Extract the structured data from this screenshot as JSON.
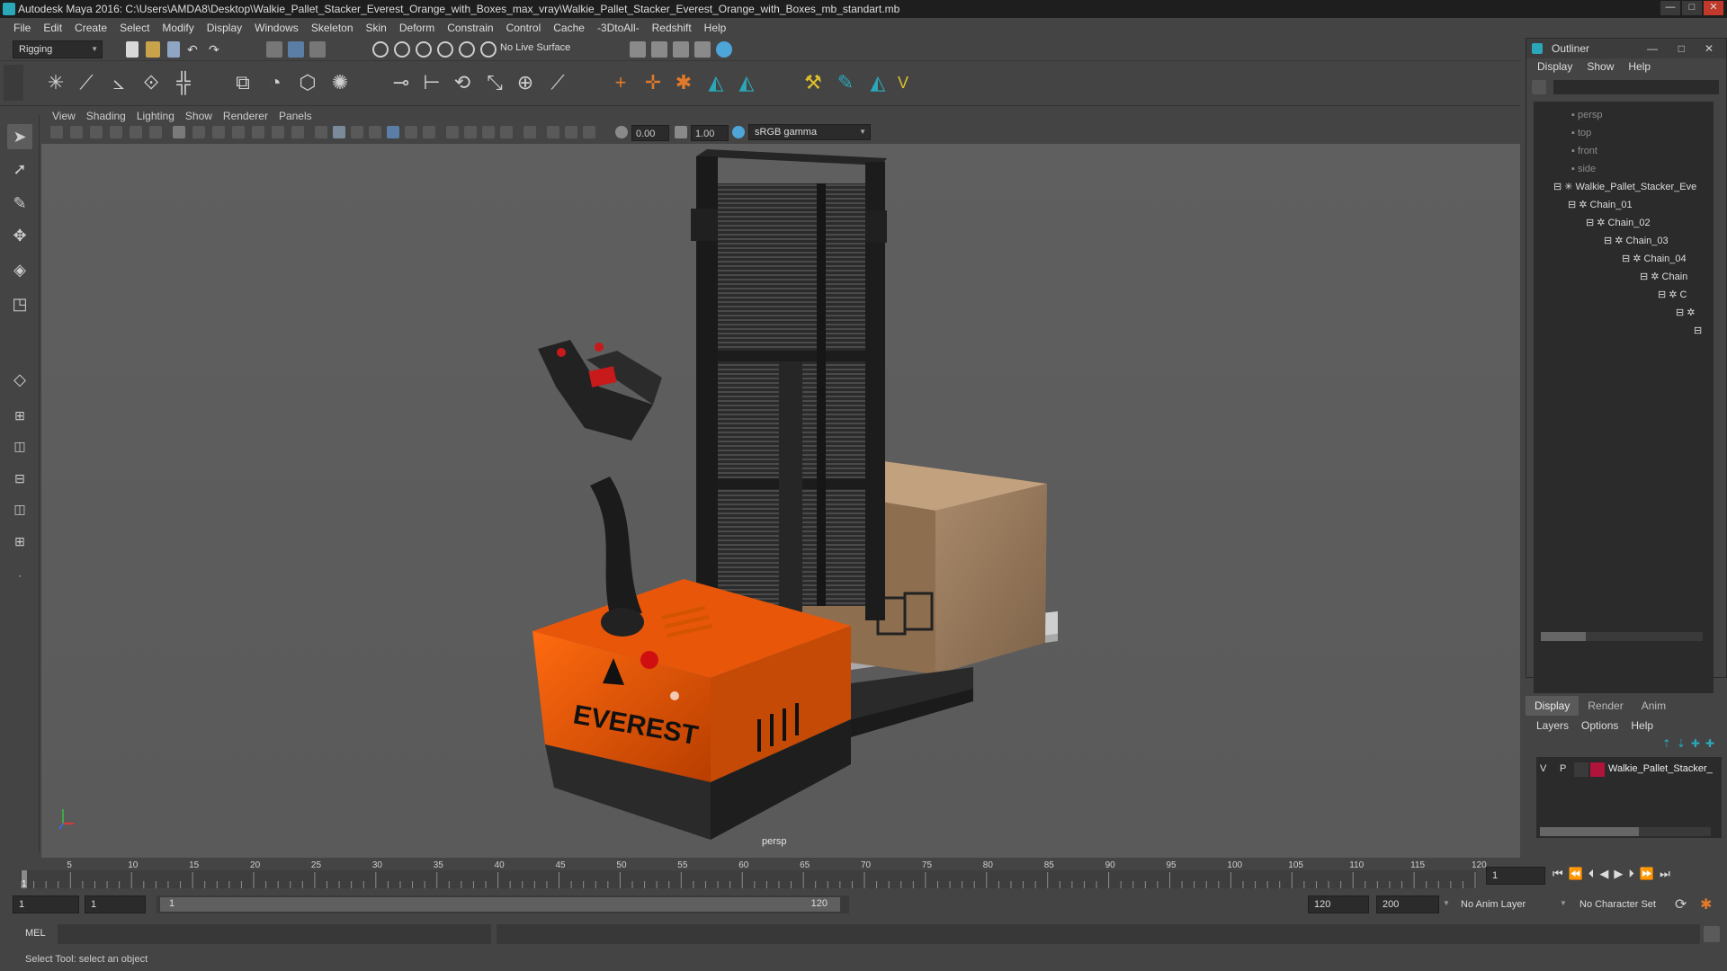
{
  "window": {
    "title": "Autodesk Maya 2016: C:\\Users\\AMDA8\\Desktop\\Walkie_Pallet_Stacker_Everest_Orange_with_Boxes_max_vray\\Walkie_Pallet_Stacker_Everest_Orange_with_Boxes_mb_standart.mb",
    "buttons": [
      "—",
      "□",
      "✕"
    ]
  },
  "menu": [
    "File",
    "Edit",
    "Create",
    "Select",
    "Modify",
    "Display",
    "Windows",
    "Skeleton",
    "Skin",
    "Deform",
    "Constrain",
    "Control",
    "Cache",
    "-3DtoAll-",
    "Redshift",
    "Help"
  ],
  "status": {
    "mode": "Rigging",
    "live_surface": "No Live Surface"
  },
  "panel": {
    "menu": [
      "View",
      "Shading",
      "Lighting",
      "Show",
      "Renderer",
      "Panels"
    ],
    "exposure": "0.00",
    "gamma": "1.00",
    "colorspace": "sRGB gamma",
    "camera_label": "persp"
  },
  "model": {
    "brand_text": "EVEREST"
  },
  "timeline": {
    "ticks": [
      "5",
      "10",
      "15",
      "20",
      "25",
      "30",
      "35",
      "40",
      "45",
      "50",
      "55",
      "60",
      "65",
      "70",
      "75",
      "80",
      "85",
      "90",
      "95",
      "100",
      "105",
      "110",
      "115",
      "120"
    ],
    "current_frame": "1",
    "frame_field": "1"
  },
  "range": {
    "start": "1",
    "playback_start": "1",
    "slider_start": "1",
    "slider_end": "120",
    "playback_end": "120",
    "end": "200",
    "anim_layer": "No Anim Layer",
    "character_set": "No Character Set"
  },
  "command": {
    "label": "MEL"
  },
  "helpline": "Select Tool: select an object",
  "outliner": {
    "title": "Outliner",
    "menu": [
      "Display",
      "Show",
      "Help"
    ],
    "cameras": [
      "persp",
      "top",
      "front",
      "side"
    ],
    "root": "Walkie_Pallet_Stacker_Eve",
    "chain": [
      "Chain_01",
      "Chain_02",
      "Chain_03",
      "Chain_04",
      "Chain",
      "C"
    ]
  },
  "layers": {
    "tabs": [
      "Display",
      "Render",
      "Anim"
    ],
    "menu": [
      "Layers",
      "Options",
      "Help"
    ],
    "row": {
      "v": "V",
      "p": "P",
      "name": "Walkie_Pallet_Stacker_",
      "color": "#b0143a"
    }
  }
}
